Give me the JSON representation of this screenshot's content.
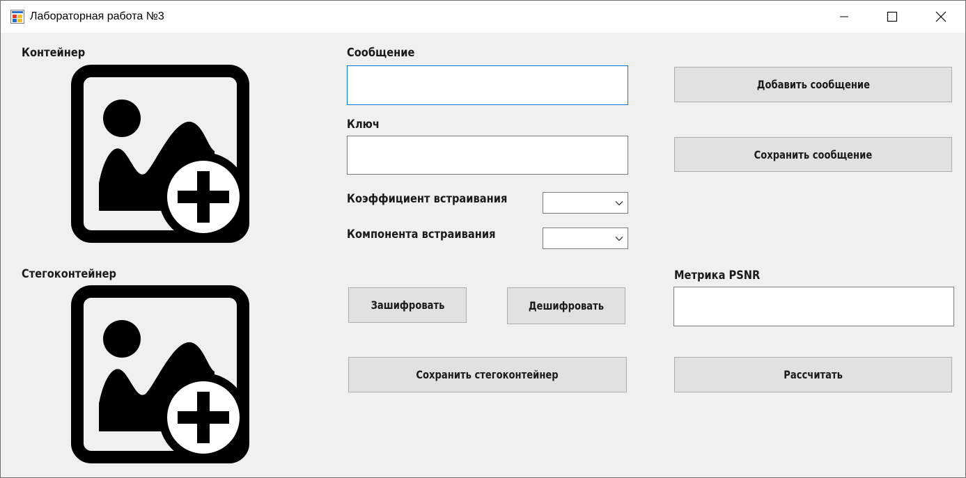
{
  "window": {
    "title": "Лабораторная работа №3",
    "app_icon": "windows-form-icon",
    "controls": {
      "minimize_icon": "minimize-icon",
      "maximize_icon": "maximize-icon",
      "close_icon": "close-icon"
    }
  },
  "container": {
    "label": "Контейнер",
    "icon": "add-image-icon"
  },
  "stegocontainer": {
    "label": "Стегоконтейнер",
    "icon": "add-image-icon"
  },
  "message": {
    "label": "Сообщение",
    "value": "",
    "placeholder": ""
  },
  "key": {
    "label": "Ключ",
    "value": "",
    "placeholder": ""
  },
  "embedding_coefficient": {
    "label": "Коэффициент встраивания",
    "selected": ""
  },
  "embedding_component": {
    "label": "Компонента встраивания",
    "selected": ""
  },
  "buttons": {
    "add_message": "Добавить сообщение",
    "save_message": "Сохранить сообщение",
    "encrypt": "Зашифровать",
    "decrypt": "Дешифровать",
    "save_stegocontainer": "Сохранить стегоконтейнер",
    "calculate": "Рассчитать"
  },
  "psnr": {
    "label": "Метрика PSNR",
    "value": ""
  },
  "colors": {
    "focus_border": "#0078d7",
    "button_bg": "#e1e1e1",
    "window_bg": "#f0f0f0"
  }
}
